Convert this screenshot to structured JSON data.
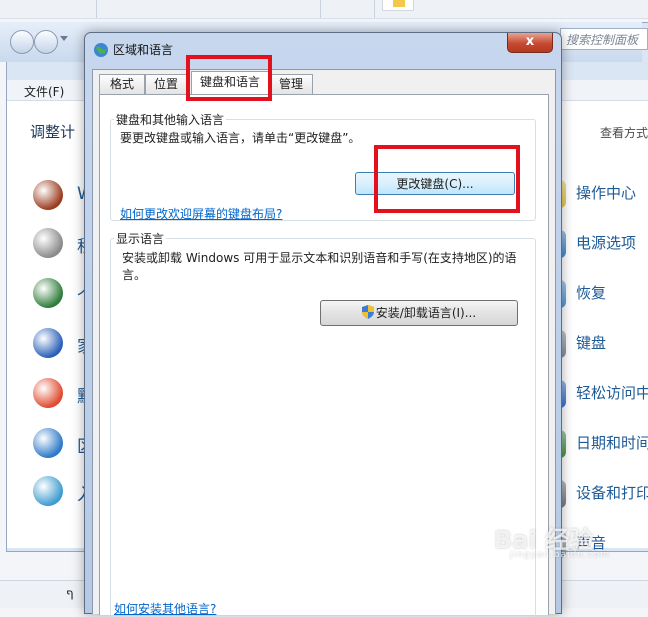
{
  "background": {
    "menu": {
      "file": "文件(F)"
    },
    "search_placeholder": "搜索控制面板",
    "heading": "调整计",
    "view_by": "查看方式",
    "left_items": [
      {
        "label": "W",
        "color": "#9b3b1e"
      },
      {
        "label": "程",
        "color": "#8a8a8a"
      },
      {
        "label": "个",
        "color": "#2f7d3a"
      },
      {
        "label": "家",
        "color": "#2a5fb8"
      },
      {
        "label": "默",
        "color": "#e04a2f"
      },
      {
        "label": "区",
        "color": "#2d79c7"
      },
      {
        "label": "入",
        "color": "#3f9bd0"
      }
    ],
    "right_items": [
      {
        "label": "操作中心",
        "color": "#e6c23a"
      },
      {
        "label": "电源选项",
        "color": "#3a7fc4"
      },
      {
        "label": "恢复",
        "color": "#4a8fd0"
      },
      {
        "label": "键盘",
        "color": "#7d8896"
      },
      {
        "label": "轻松访问中",
        "color": "#2f68c8"
      },
      {
        "label": "日期和时间",
        "color": "#3f8a3f"
      },
      {
        "label": "设备和打印",
        "color": "#6b7480"
      },
      {
        "label": "声音",
        "color": "#8f98a3"
      }
    ],
    "status_glyph": "ף"
  },
  "dialog": {
    "title": "区域和语言",
    "close_label": "x",
    "tabs": [
      {
        "label": "格式",
        "active": false
      },
      {
        "label": "位置",
        "active": false
      },
      {
        "label": "键盘和语言",
        "active": true
      },
      {
        "label": "管理",
        "active": false
      }
    ],
    "keyboards": {
      "label": "键盘和其他输入语言",
      "text": "要更改键盘或输入语言，请单击“更改键盘”。",
      "button": "更改键盘(C)...",
      "link": "如何更改欢迎屏幕的键盘布局?"
    },
    "display_language": {
      "label": "显示语言",
      "text": "安装或卸载 Windows 可用于显示文本和识别语音和手写(在支持地区)的语言。",
      "button": "安装/卸载语言(I)..."
    },
    "bottom_link": "如何安装其他语言?"
  },
  "watermark": {
    "text": "Bai 经验",
    "sub": "jingyan.baidu.com"
  },
  "annotation_color": "#e3101d"
}
